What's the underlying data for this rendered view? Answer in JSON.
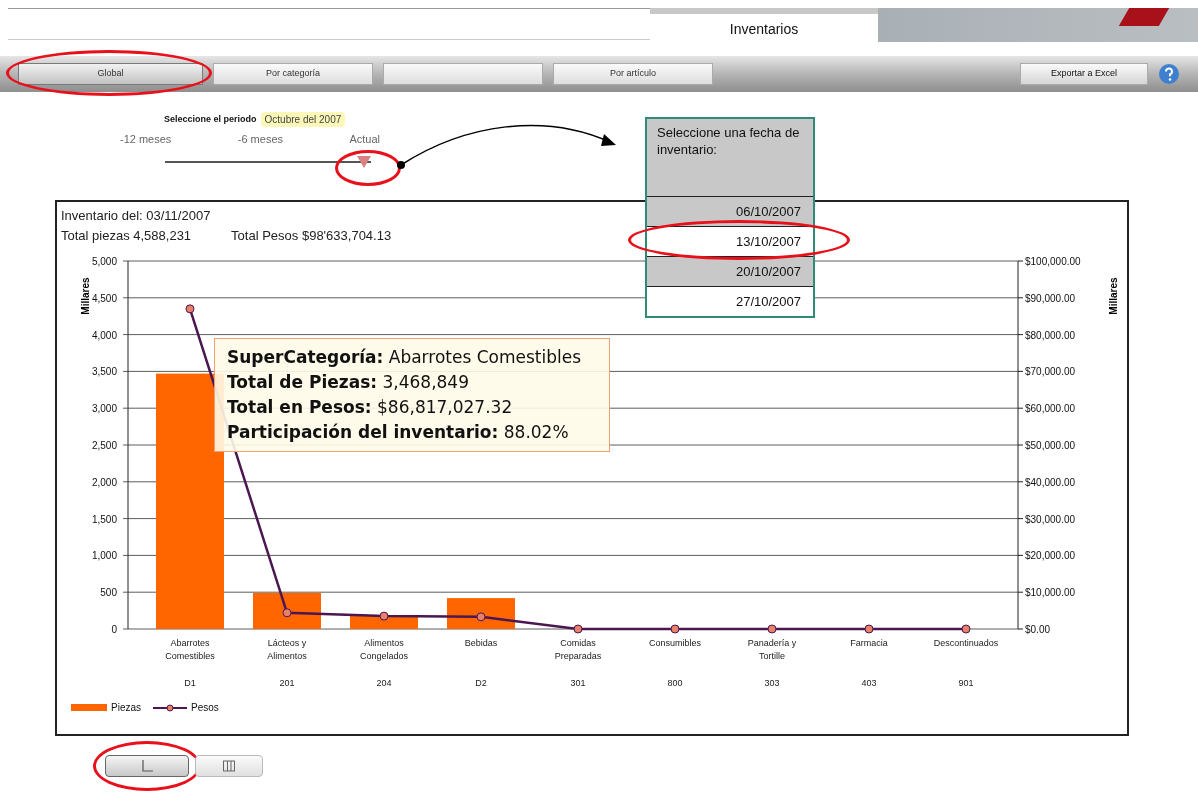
{
  "header": {
    "tab": "Inventarios"
  },
  "toolbar": {
    "tabs": [
      {
        "label": "Global",
        "selected": true
      },
      {
        "label": "Por categoría",
        "selected": false
      },
      {
        "selected": false
      },
      {
        "label": "Por artículo",
        "selected": false
      }
    ],
    "export_button": "Exportar a Excel"
  },
  "period": {
    "label": "Seleccione el periodo",
    "tooltip": "Octubre del 2007",
    "ticks": [
      "-12 meses",
      "-6 meses",
      "Actual"
    ],
    "level": 1
  },
  "date_picker": {
    "title": "Seleccione una fecha de inventario:",
    "dates": [
      {
        "label": "06/10/2007",
        "selected": false
      },
      {
        "label": "13/10/2007",
        "selected": true
      },
      {
        "label": "20/10/2007",
        "selected": false
      },
      {
        "label": "27/10/2007",
        "selected": false
      }
    ]
  },
  "summary": {
    "date": "Inventario del: 03/11/2007",
    "pieces": "Total piezas 4,588,231",
    "pesos": "Total Pesos $98'633,704.13"
  },
  "chart": {
    "category_codes": [
      "D1",
      "201",
      "204",
      "D2",
      "301",
      "800",
      "303",
      "403",
      "901"
    ],
    "tooltip": [
      "**SuperCategoría:** Abarrotes Comestibles",
      "**Total de Piezas:** 3,468,849",
      "**Total en Pesos:**  $86,817,027.32",
      "**Participación del inventario:** 88.02%"
    ],
    "chart_data": {
      "type": "bar",
      "ylabel": "Millares",
      "grid": true,
      "categories": [
        "Abarrotes Comestibles",
        "Lácteos y Alimentos",
        "Alimentos Congelados",
        "Bebidas",
        "Comidas Preparadas",
        "Consumibles",
        "Panadería y Tortille",
        "Farmacia",
        "Descontinuados"
      ],
      "ylim": [
        0,
        5000
      ],
      "yticks": [
        {
          "value": 5000,
          "label": "5,000"
        },
        {
          "value": 4500,
          "label": "4,500"
        },
        {
          "value": 4000,
          "label": "4,000"
        },
        {
          "value": 3500,
          "label": "3,500"
        },
        {
          "value": 3000,
          "label": "3,000"
        },
        {
          "value": 2500,
          "label": "2,500"
        },
        {
          "value": 2000,
          "label": "2,000"
        },
        {
          "value": 1500,
          "label": "1,500"
        },
        {
          "value": 1000,
          "label": "1,000"
        },
        {
          "value": 500,
          "label": "500"
        },
        {
          "value": 0,
          "label": "0"
        }
      ],
      "series": [
        {
          "name": "Piezas",
          "color": "#ff6600",
          "values": [
            3470,
            490,
            180,
            420,
            0,
            0,
            0,
            0,
            0
          ]
        }
      ]
    },
    "pesos_axis": {
      "chart_data": {
        "type": "line",
        "ylabel": "Millares",
        "ylim": [
          0,
          100000
        ],
        "yticks": [
          {
            "value": 100000,
            "label": "$100,000.00"
          },
          {
            "value": 90000,
            "label": "$90,000.00"
          },
          {
            "value": 80000,
            "label": "$80,000.00"
          },
          {
            "value": 70000,
            "label": "$70,000.00"
          },
          {
            "value": 60000,
            "label": "$60,000.00"
          },
          {
            "value": 50000,
            "label": "$50,000.00"
          },
          {
            "value": 40000,
            "label": "$40,000.00"
          },
          {
            "value": 30000,
            "label": "$30,000.00"
          },
          {
            "value": 20000,
            "label": "$20,000.00"
          },
          {
            "value": 10000,
            "label": "$10,000.00"
          },
          {
            "value": 0,
            "label": "$0.00"
          }
        ],
        "series": [
          {
            "name": "Pesos",
            "color": "#4b1750",
            "marker": "circle",
            "values": [
              87000,
              4400,
              3500,
              3300,
              0,
              0,
              0,
              0,
              0
            ]
          }
        ]
      }
    }
  },
  "view_toggle": [
    {
      "kind": "line",
      "selected": true
    },
    {
      "kind": "table",
      "selected": false
    }
  ]
}
